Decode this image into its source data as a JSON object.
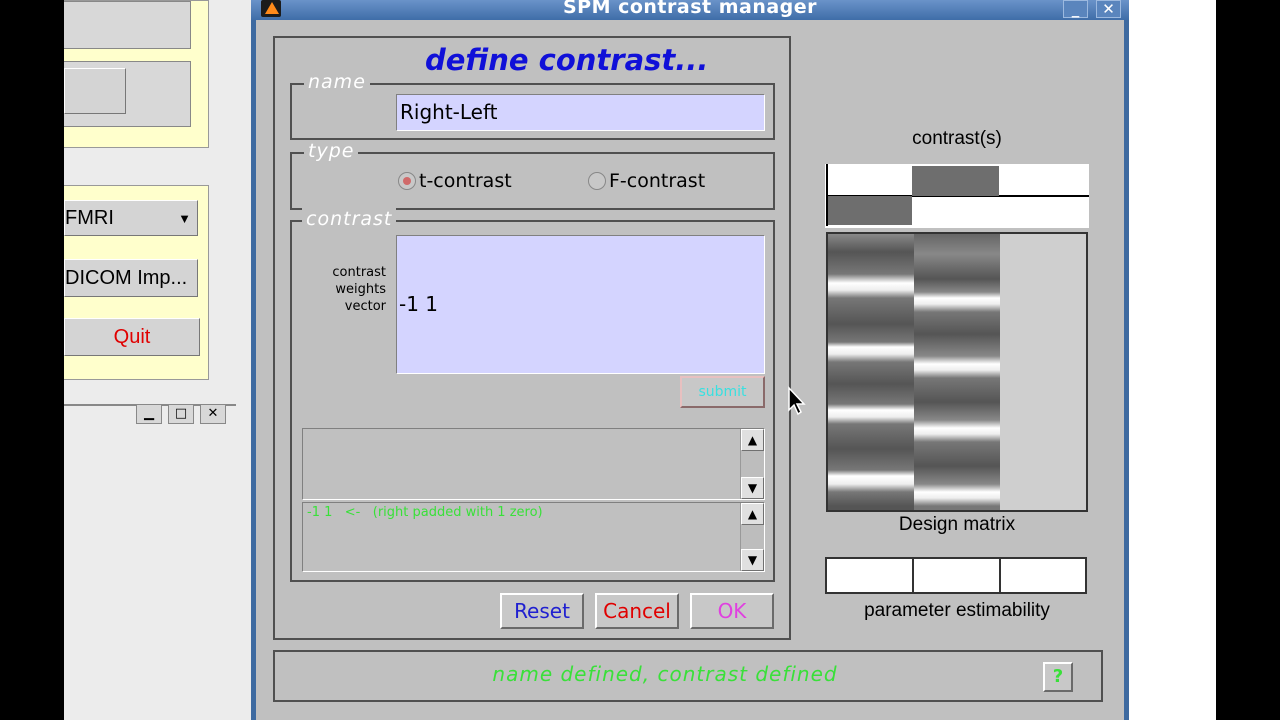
{
  "background_window": {
    "modality_select": "FMRI",
    "dicom_button": "DICOM Imp...",
    "quit_button": "Quit",
    "quit_color": "#e00000"
  },
  "window": {
    "title": "SPM contrast manager",
    "minimize": "_",
    "close": "✕"
  },
  "define": {
    "heading": "define contrast...",
    "name_legend": "name",
    "name_value": "Right-Left",
    "type_legend": "type",
    "type_options": [
      {
        "label": "t-contrast",
        "selected": true
      },
      {
        "label": "F-contrast",
        "selected": false
      }
    ],
    "contrast_legend": "contrast",
    "weights_label": "contrast\nweights\nvector",
    "weights_value": "-1 1",
    "submit_button": "submit",
    "errors_list": [],
    "info_list": [
      "-1 1   <-   (right padded with 1 zero)"
    ],
    "info_color": "#39e039"
  },
  "buttons": {
    "reset": "Reset",
    "reset_color": "#2020d0",
    "cancel": "Cancel",
    "cancel_color": "#e00000",
    "ok": "OK",
    "ok_color": "#e040e0"
  },
  "right_panel": {
    "contrasts_label": "contrast(s)",
    "design_matrix_label": "Design matrix",
    "estimability_label": "parameter estimability",
    "contrast_weights": [
      -1,
      1,
      0
    ]
  },
  "status": {
    "text": "name defined, contrast defined",
    "help_button": "?"
  }
}
